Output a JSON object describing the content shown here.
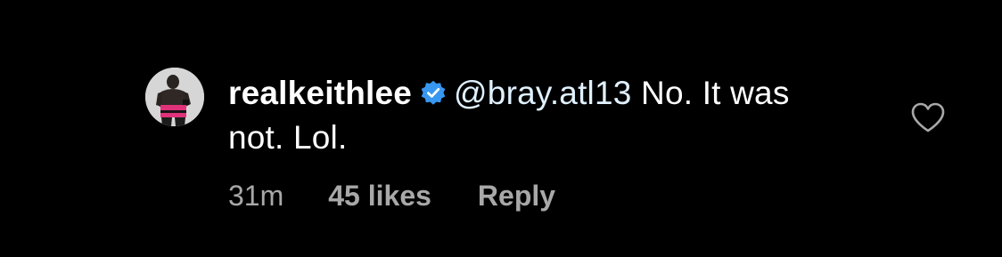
{
  "comment": {
    "username": "realkeithlee",
    "verified": true,
    "mention": "@bray.atl13",
    "text": "No. It was not. Lol.",
    "time": "31m",
    "likes": "45 likes",
    "reply_label": "Reply"
  },
  "icons": {
    "avatar": "profile-photo",
    "verified": "verified-badge-icon",
    "like": "heart-outline-icon"
  },
  "colors": {
    "background": "#000000",
    "text": "#ffffff",
    "mention": "#e0f1ff",
    "meta": "#a8a8a8",
    "verified": "#3897f0"
  }
}
